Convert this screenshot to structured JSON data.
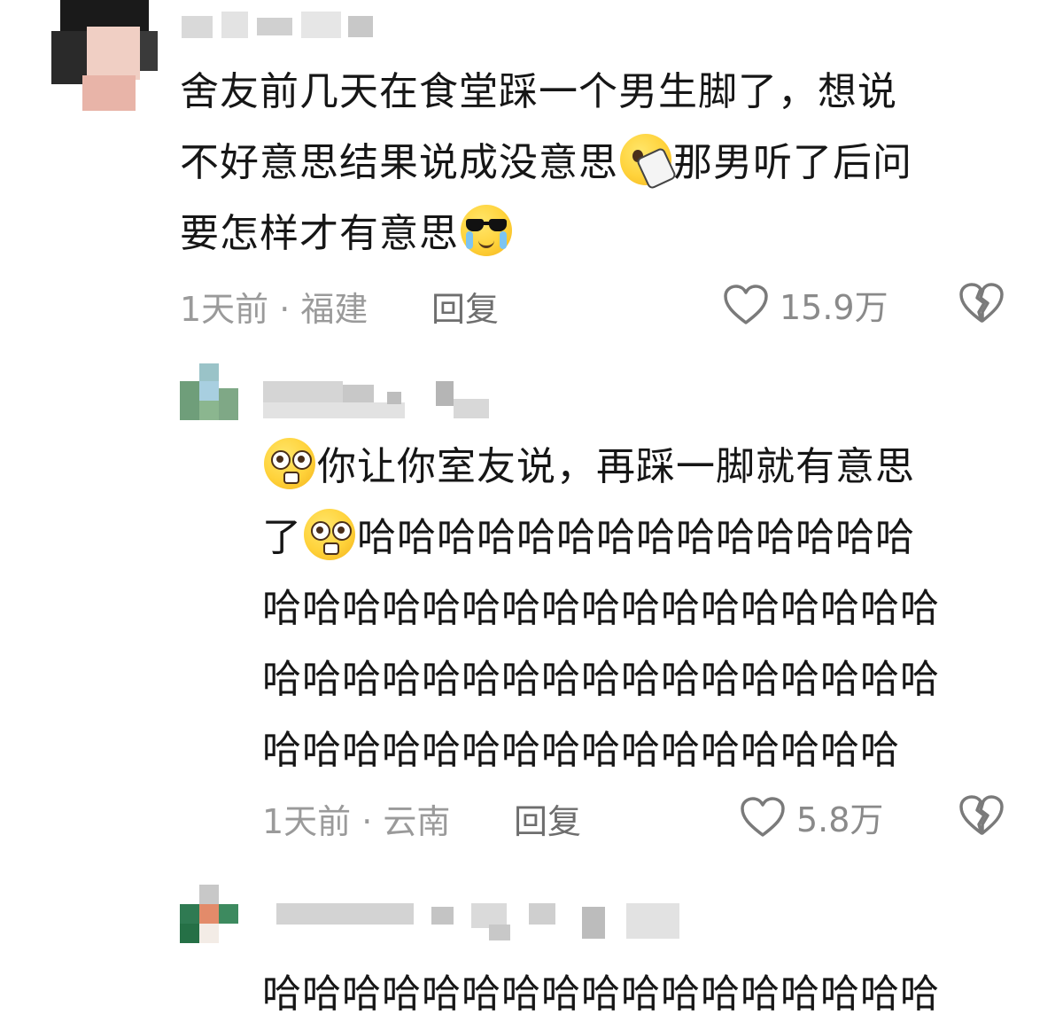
{
  "comment1": {
    "line1": "舍友前几天在食堂踩一个男生脚了，想说",
    "line2a": "不好意思结果说成没意思",
    "line2b": "那男听了后问",
    "line3": "要怎样才有意思",
    "emoji1": "facepalm-emoji",
    "emoji2": "sunglasses-crying-emoji",
    "time_location": "1天前 · 福建",
    "reply": "回复",
    "likes": "15.9万"
  },
  "comment2": {
    "line1": "你让你室友说，再踩一脚就有意思",
    "line2a": "了",
    "line2b": "哈哈哈哈哈哈哈哈哈哈哈哈哈哈",
    "line3": "哈哈哈哈哈哈哈哈哈哈哈哈哈哈哈哈哈",
    "line4": "哈哈哈哈哈哈哈哈哈哈哈哈哈哈哈哈哈",
    "line5": "哈哈哈哈哈哈哈哈哈哈哈哈哈哈哈哈",
    "emoji1": "pleading-emoji",
    "emoji2": "pleading-emoji",
    "time_location": "1天前 · 云南",
    "reply": "回复",
    "likes": "5.8万"
  },
  "comment3": {
    "line1": "哈哈哈哈哈哈哈哈哈哈哈哈哈哈哈哈哈"
  },
  "icons": {
    "like": "heart-outline-icon",
    "dislike": "broken-heart-icon"
  }
}
